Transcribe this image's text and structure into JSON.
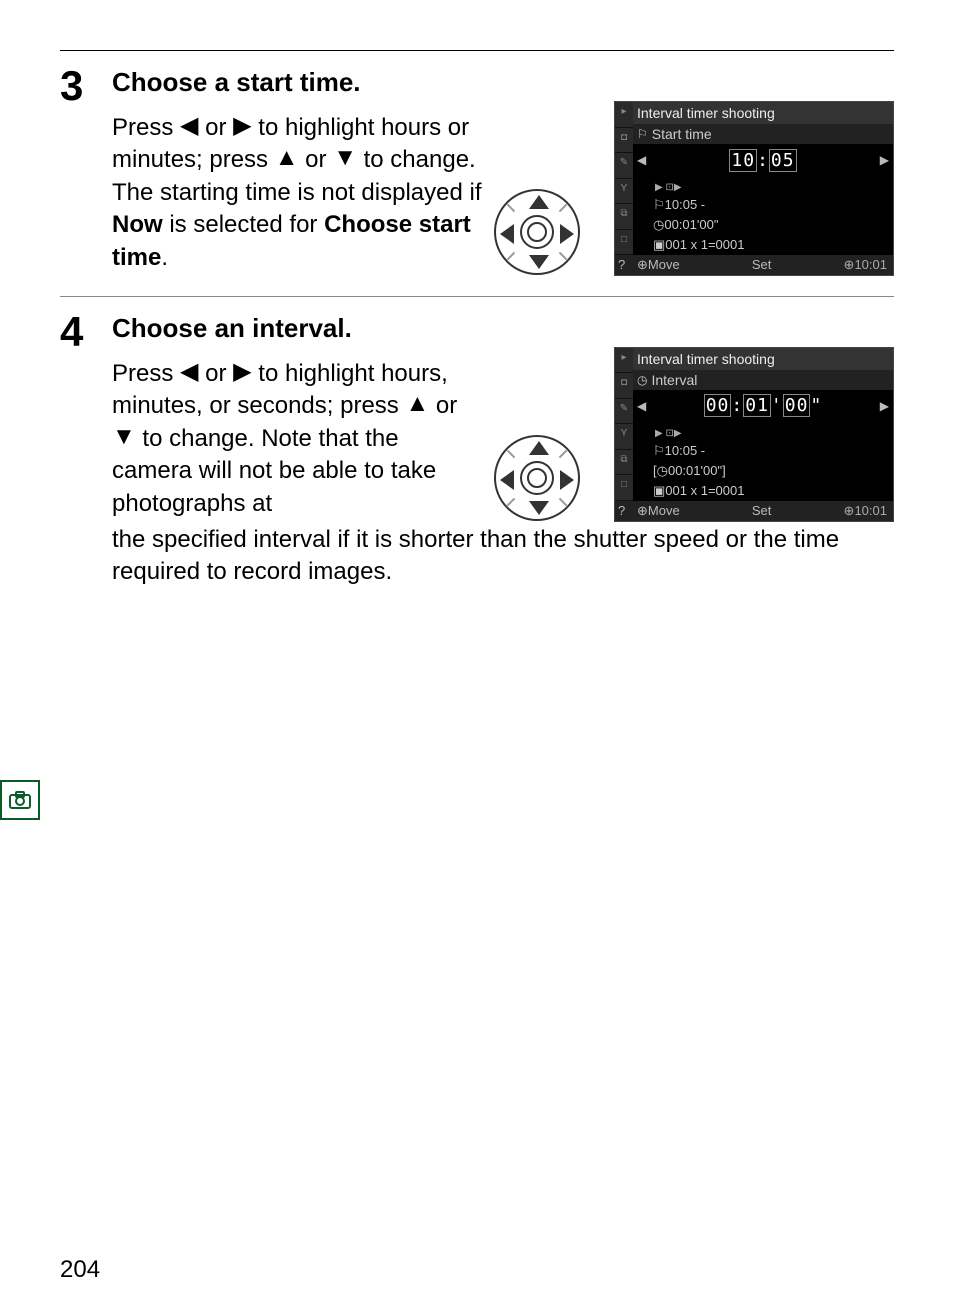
{
  "page_number": "204",
  "step3": {
    "num": "3",
    "title": "Choose a start time.",
    "text_pre": "Press ",
    "text_mid1": " or ",
    "text_seg1": " to highlight hours or minutes; press ",
    "text_mid2": " or ",
    "text_seg2": " to change.  The starting time is not displayed if ",
    "text_bold1": "Now",
    "text_seg3": " is selected for ",
    "text_bold2": "Choose start time",
    "text_end": "."
  },
  "step4": {
    "num": "4",
    "title": "Choose an interval.",
    "narrow_pre": "Press ",
    "narrow_mid1": " or ",
    "narrow_seg1": " to highlight hours, minutes, or seconds; press ",
    "narrow_mid2": " or ",
    "narrow_seg2": " to change.  Note that the camera will not be able to take photographs at",
    "wide": "the specified interval if it is shorter than the shutter speed or the time required to record images."
  },
  "lcd3": {
    "header": "Interval timer shooting",
    "sub_label": "Start time",
    "value_h": "10",
    "value_m": "05",
    "d_anim": "▶ ⊡▶",
    "d_start": "10:05 -",
    "d_interval": "00:01'00\"",
    "d_count": "001 x 1=0001",
    "foot_move": "Move",
    "foot_set": "Set",
    "foot_time": "10:01"
  },
  "lcd4": {
    "header": "Interval timer shooting",
    "sub_label": "Interval",
    "value_h": "00",
    "value_m": "01",
    "value_s": "00",
    "d_anim": "▶ ⊡▶",
    "d_start": "10:05 -",
    "d_interval": "00:01'00\"",
    "d_count": "001 x 1=0001",
    "foot_move": "Move",
    "foot_set": "Set",
    "foot_time": "10:01"
  },
  "glyphs": {
    "left": "◀",
    "right": "▶",
    "up": "▲",
    "down": "▼",
    "clock": "⊕",
    "flag": "⚐",
    "circle_clock": "◷",
    "stack": "▣"
  }
}
